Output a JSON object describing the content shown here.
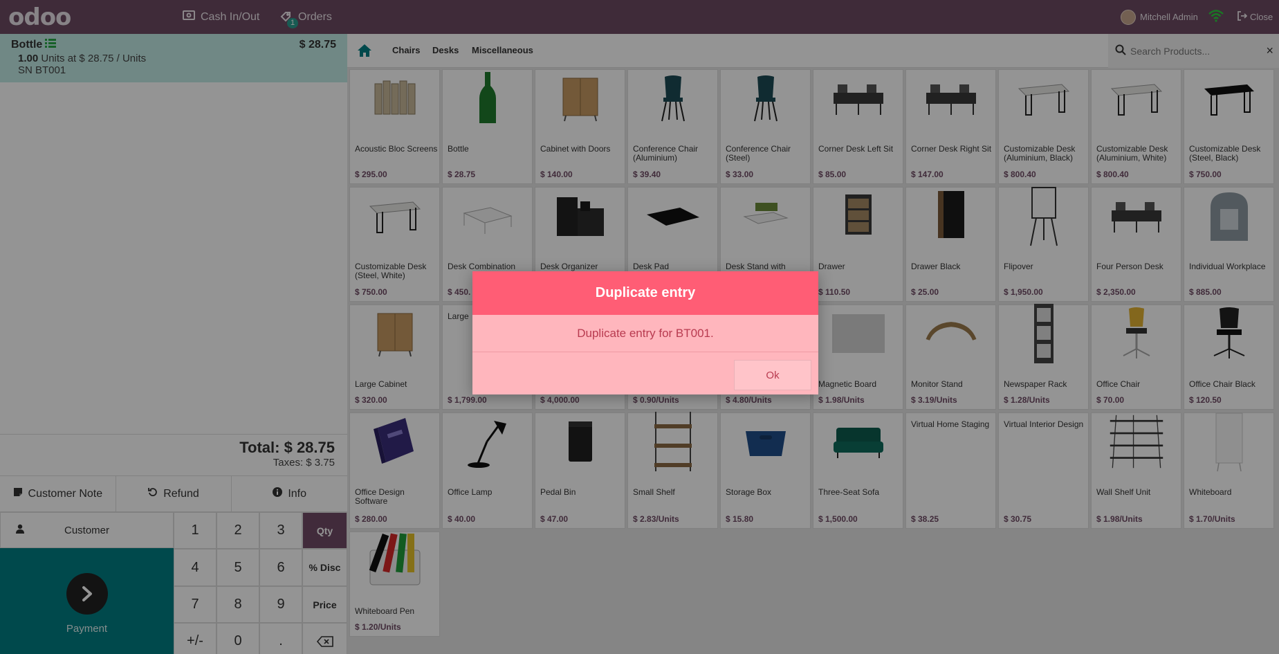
{
  "topbar": {
    "logo": "odoo",
    "cash_in_out": "Cash In/Out",
    "orders": "Orders",
    "orders_badge": "1",
    "user": "Mitchell Admin",
    "close": "Close"
  },
  "order": {
    "line": {
      "product": "Bottle",
      "price": "$ 28.75",
      "qty": "1.00",
      "detail": "Units at $ 28.75 / Units",
      "serial": "SN BT001"
    },
    "total": "Total: $ 28.75",
    "taxes": "Taxes: $ 3.75"
  },
  "controls": {
    "customer_note": "Customer Note",
    "refund": "Refund",
    "info": "Info",
    "customer": "Customer",
    "payment": "Payment"
  },
  "numpad": [
    "1",
    "2",
    "3",
    "Qty",
    "4",
    "5",
    "6",
    "% Disc",
    "7",
    "8",
    "9",
    "Price",
    "+/-",
    "0",
    "."
  ],
  "categories": {
    "chairs": "Chairs",
    "desks": "Desks",
    "misc": "Miscellaneous",
    "search_placeholder": "Search Products..."
  },
  "products": [
    {
      "name": "Acoustic Bloc Screens",
      "price": "$ 295.00",
      "icon": "screens"
    },
    {
      "name": "Bottle",
      "price": "$ 28.75",
      "icon": "bottle"
    },
    {
      "name": "Cabinet with Doors",
      "price": "$ 140.00",
      "icon": "cabinet"
    },
    {
      "name": "Conference Chair (Aluminium)",
      "price": "$ 39.40",
      "icon": "chair"
    },
    {
      "name": "Conference Chair (Steel)",
      "price": "$ 33.00",
      "icon": "chair"
    },
    {
      "name": "Corner Desk Left Sit",
      "price": "$ 85.00",
      "icon": "desk-set"
    },
    {
      "name": "Corner Desk Right Sit",
      "price": "$ 147.00",
      "icon": "desk-set"
    },
    {
      "name": "Customizable Desk (Aluminium, Black)",
      "price": "$ 800.40",
      "icon": "desk"
    },
    {
      "name": "Customizable Desk (Aluminium, White)",
      "price": "$ 800.40",
      "icon": "desk"
    },
    {
      "name": "Customizable Desk (Steel, Black)",
      "price": "$ 750.00",
      "icon": "desk-black"
    },
    {
      "name": "Customizable Desk (Steel, White)",
      "price": "$ 750.00",
      "icon": "desk"
    },
    {
      "name": "Desk Combination",
      "price": "$ 450.",
      "icon": "desk-combo"
    },
    {
      "name": "Desk Organizer",
      "price": "",
      "icon": "organizer"
    },
    {
      "name": "Desk Pad",
      "price": "",
      "icon": "pad"
    },
    {
      "name": "Desk Stand with",
      "price": "",
      "icon": "stand"
    },
    {
      "name": "Drawer",
      "price": "$ 110.50",
      "icon": "drawer"
    },
    {
      "name": "Drawer Black",
      "price": "$ 25.00",
      "icon": "drawer-black"
    },
    {
      "name": "Flipover",
      "price": "$ 1,950.00",
      "icon": "flipover"
    },
    {
      "name": "Four Person Desk",
      "price": "$ 2,350.00",
      "icon": "desk-set"
    },
    {
      "name": "Individual Workplace",
      "price": "$ 885.00",
      "icon": "pod"
    },
    {
      "name": "Large Cabinet",
      "price": "$ 320.00",
      "icon": "cabinet"
    },
    {
      "name": "Large",
      "price": "$ 1,799.00",
      "icon": "none"
    },
    {
      "name": "",
      "price": "$ 4,000.00",
      "icon": "none"
    },
    {
      "name": "",
      "price": "$ 0.90/Units",
      "icon": "none"
    },
    {
      "name": "",
      "price": "$ 4.80/Units",
      "icon": "none"
    },
    {
      "name": "Magnetic Board",
      "price": "$ 1.98/Units",
      "icon": "board"
    },
    {
      "name": "Monitor Stand",
      "price": "$ 3.19/Units",
      "icon": "monitor"
    },
    {
      "name": "Newspaper Rack",
      "price": "$ 1.28/Units",
      "icon": "rack"
    },
    {
      "name": "Office Chair",
      "price": "$ 70.00",
      "icon": "office-chair"
    },
    {
      "name": "Office Chair Black",
      "price": "$ 120.50",
      "icon": "office-chair-black"
    },
    {
      "name": "Office Design Software",
      "price": "$ 280.00",
      "icon": "software"
    },
    {
      "name": "Office Lamp",
      "price": "$ 40.00",
      "icon": "lamp"
    },
    {
      "name": "Pedal Bin",
      "price": "$ 47.00",
      "icon": "bin"
    },
    {
      "name": "Small Shelf",
      "price": "$ 2.83/Units",
      "icon": "shelf"
    },
    {
      "name": "Storage Box",
      "price": "$ 15.80",
      "icon": "box"
    },
    {
      "name": "Three-Seat Sofa",
      "price": "$ 1,500.00",
      "icon": "sofa"
    },
    {
      "name": "Virtual Home Staging",
      "price": "$ 38.25",
      "icon": "none"
    },
    {
      "name": "Virtual Interior Design",
      "price": "$ 30.75",
      "icon": "none"
    },
    {
      "name": "Wall Shelf Unit",
      "price": "$ 1.98/Units",
      "icon": "wall-shelf"
    },
    {
      "name": "Whiteboard",
      "price": "$ 1.70/Units",
      "icon": "whiteboard"
    },
    {
      "name": "Whiteboard Pen",
      "price": "$ 1.20/Units",
      "icon": "pens"
    }
  ],
  "dialog": {
    "title": "Duplicate entry",
    "message": "Duplicate entry for BT001.",
    "ok": "Ok"
  },
  "colors": {
    "topbar": "#6d4a63",
    "accent": "#714b67",
    "payment": "#017e84",
    "dialog_header": "#ff5d75",
    "dialog_body": "#ffb6bd"
  }
}
